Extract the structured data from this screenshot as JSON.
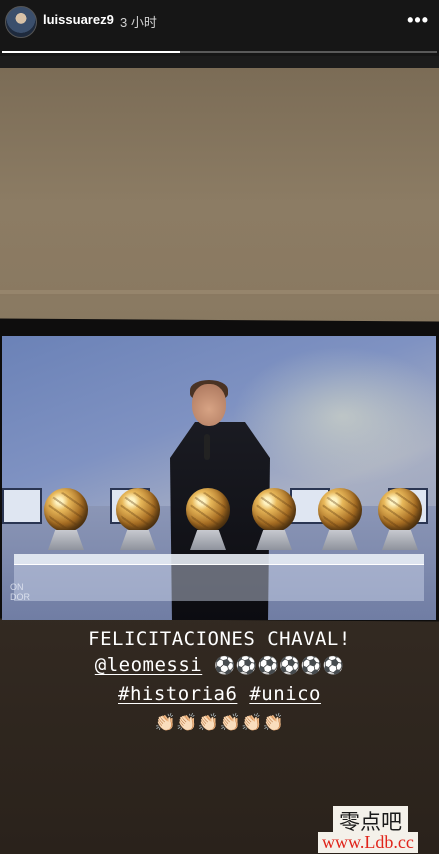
{
  "header": {
    "username": "luissuarez9",
    "time_ago": "3 小时",
    "more_icon": "•••"
  },
  "progress": {
    "fraction": 0.41
  },
  "caption": {
    "line1": "FELICITACIONES CHAVAL!",
    "mention": "@leomessi",
    "balls": "⚽⚽⚽⚽⚽⚽",
    "hashtag1": "#historia6",
    "hashtag2": "#unico",
    "clap_emoji": "👏🏻👏🏻👏🏻👏🏻👏🏻👏🏻"
  },
  "tv_logo_text": "ON\nDOR",
  "watermark": {
    "line1": "零点吧",
    "line2": "www.Ldb.cc"
  },
  "colors": {
    "watermark_red": "#e0241a",
    "progress_fill": "#ffffff"
  }
}
